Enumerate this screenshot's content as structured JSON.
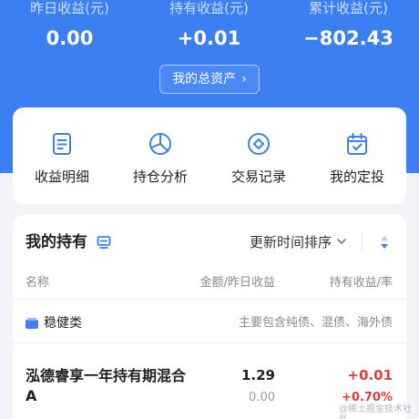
{
  "summary": {
    "yesterday_label": "昨日收益(元)",
    "yesterday_value": "0.00",
    "holding_label": "持有收益(元)",
    "holding_value": "+0.01",
    "total_label": "累计收益(元)",
    "total_value": "−802.43",
    "assets_button": "我的总资产"
  },
  "actions": [
    {
      "label": "收益明细",
      "icon": "document-list-icon"
    },
    {
      "label": "持仓分析",
      "icon": "pie-chart-icon"
    },
    {
      "label": "交易记录",
      "icon": "diamond-record-icon"
    },
    {
      "label": "我的定投",
      "icon": "calendar-check-icon"
    }
  ],
  "holdings": {
    "title": "我的持有",
    "sort_label": "更新时间排序",
    "columns": {
      "name": "名称",
      "amount": "金额/昨日收益",
      "hold": "持有收益/率"
    },
    "category": {
      "name": "稳健类",
      "desc": "主要包含纯债、混债、海外债"
    },
    "funds": [
      {
        "name": "泓德睿享一年持有期混合A",
        "amount": "1.29",
        "yesterday": "0.00",
        "hold": "+0.01",
        "rate": "+0.70%"
      }
    ]
  },
  "watermark": "@稀土掘金技术社区",
  "colors": {
    "brand_blue": "#3b7ff2",
    "gain_red": "#e43c3c",
    "muted": "#888888"
  }
}
